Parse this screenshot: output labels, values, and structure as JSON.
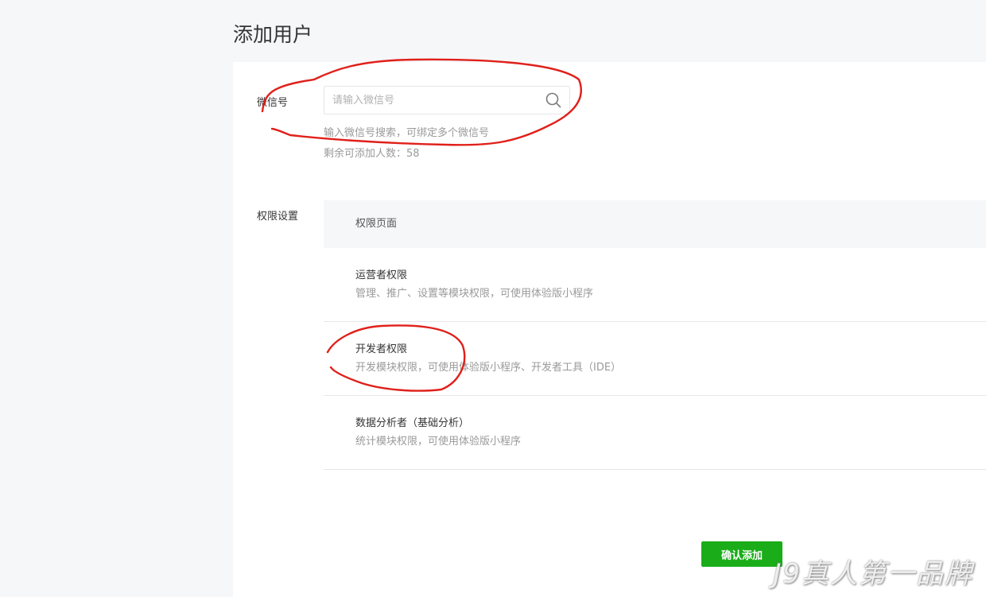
{
  "page": {
    "title": "添加用户"
  },
  "wechat": {
    "label": "微信号",
    "placeholder": "请输入微信号",
    "hint": "输入微信号搜索，可绑定多个微信号",
    "remaining": "剩余可添加人数：58"
  },
  "permissions": {
    "label": "权限设置",
    "header": "权限页面",
    "items": [
      {
        "title": "运营者权限",
        "desc": "管理、推广、设置等模块权限，可使用体验版小程序"
      },
      {
        "title": "开发者权限",
        "desc": "开发模块权限，可使用体验版小程序、开发者工具（IDE）"
      },
      {
        "title": "数据分析者（基础分析）",
        "desc": "统计模块权限，可使用体验版小程序"
      }
    ]
  },
  "actions": {
    "confirm": "确认添加"
  },
  "watermark": "J9真人第一品牌",
  "colors": {
    "primary": "#1aad19",
    "annotation": "#e0201a"
  }
}
